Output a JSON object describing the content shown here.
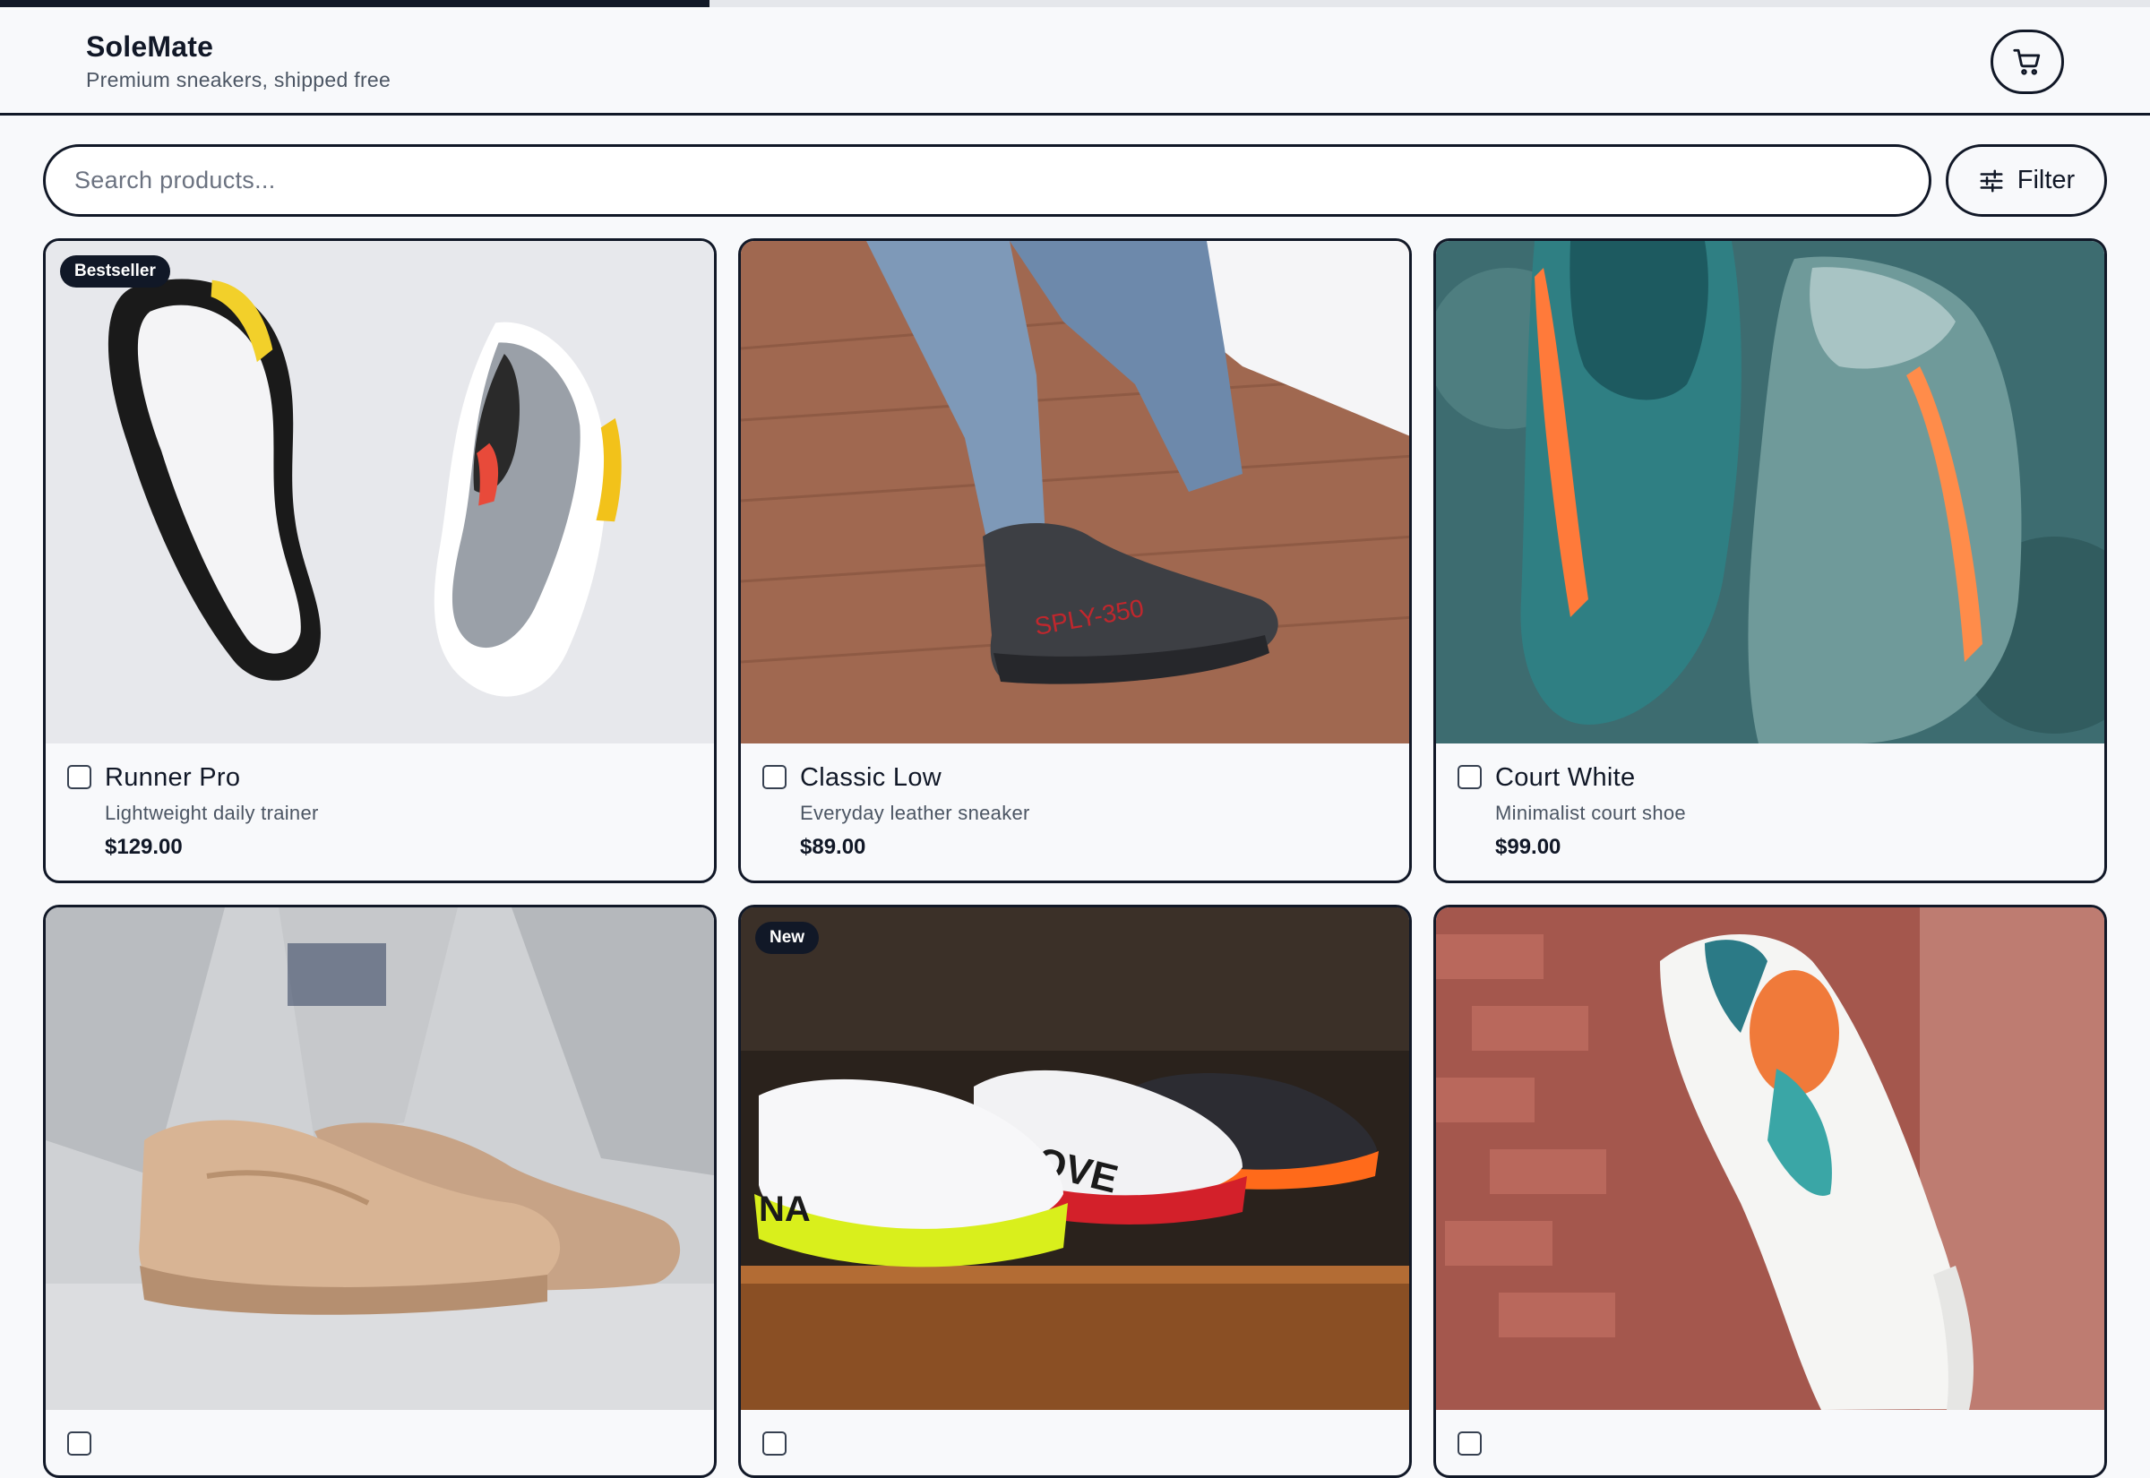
{
  "progress": {
    "value": 0.33
  },
  "header": {
    "title": "SoleMate",
    "tagline": "Premium sneakers, shipped free",
    "cart_icon": "cart-icon"
  },
  "search": {
    "placeholder": "Search products..."
  },
  "filter": {
    "label": "Filter",
    "icon": "sliders-icon"
  },
  "products": [
    {
      "name": "Runner Pro",
      "description": "Lightweight daily trainer",
      "price": "$129.00",
      "badge": "Bestseller"
    },
    {
      "name": "Classic Low",
      "description": "Everyday leather sneaker",
      "price": "$89.00"
    },
    {
      "name": "Court White",
      "description": "Minimalist court shoe",
      "price": "$99.00"
    },
    {
      "name": "",
      "description": "",
      "price": ""
    },
    {
      "name": "",
      "description": "",
      "price": "",
      "badge": "New"
    },
    {
      "name": "",
      "description": "",
      "price": ""
    }
  ],
  "colors": {
    "ink": "#111827",
    "muted": "#4b5563",
    "background": "#f8f9fb"
  }
}
